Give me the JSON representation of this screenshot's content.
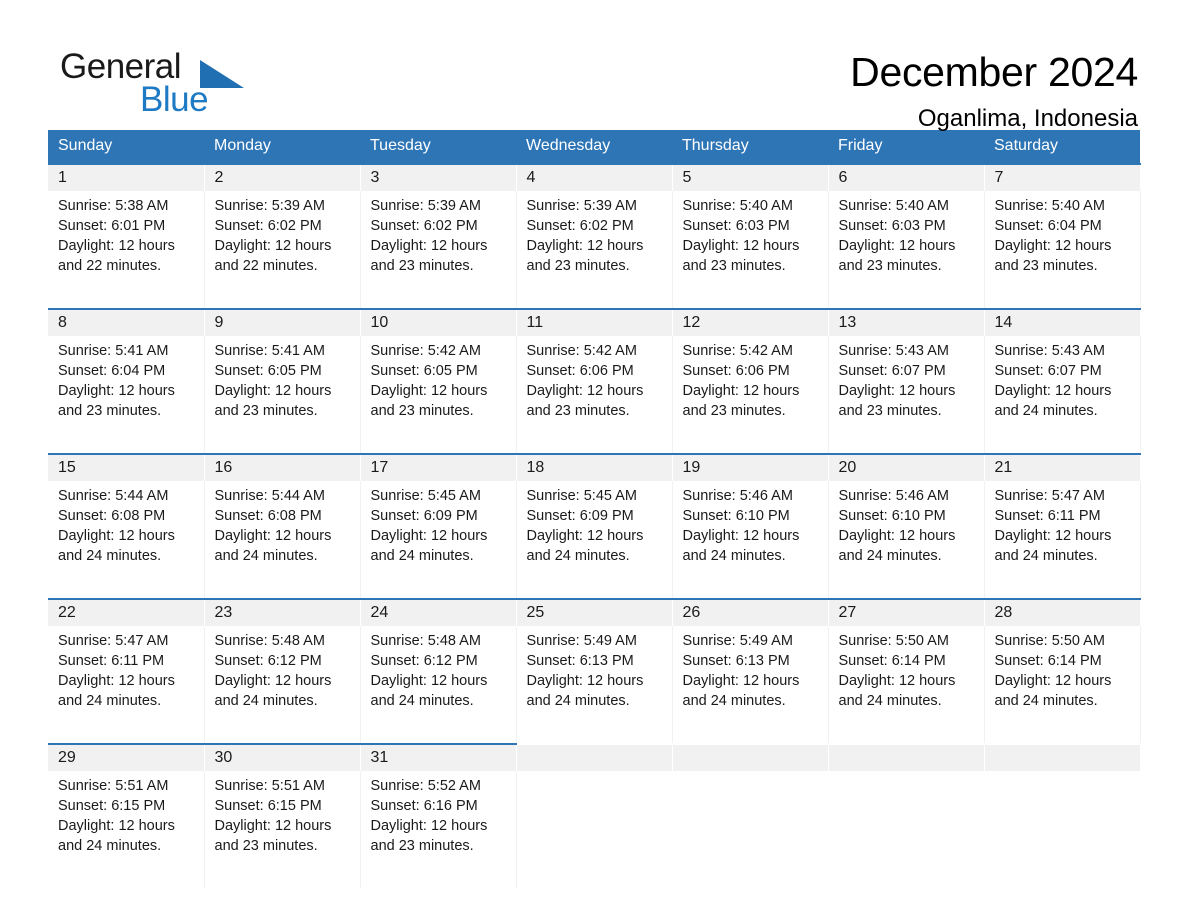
{
  "brand": {
    "name_top": "General",
    "name_bottom": "Blue",
    "triangle_color": "#1f6fb2",
    "blue_text_color": "#1f7ac4"
  },
  "header": {
    "title": "December 2024",
    "location": "Oganlima, Indonesia"
  },
  "theme": {
    "header_blue": "#2e75b6",
    "day_band_gray": "#f1f1f1",
    "text": "#1a1a1a"
  },
  "weekday_headers": [
    "Sunday",
    "Monday",
    "Tuesday",
    "Wednesday",
    "Thursday",
    "Friday",
    "Saturday"
  ],
  "weeks": [
    {
      "days": [
        {
          "number": "1",
          "sunrise": "Sunrise: 5:38 AM",
          "sunset": "Sunset: 6:01 PM",
          "daylight1": "Daylight: 12 hours",
          "daylight2": "and 22 minutes."
        },
        {
          "number": "2",
          "sunrise": "Sunrise: 5:39 AM",
          "sunset": "Sunset: 6:02 PM",
          "daylight1": "Daylight: 12 hours",
          "daylight2": "and 22 minutes."
        },
        {
          "number": "3",
          "sunrise": "Sunrise: 5:39 AM",
          "sunset": "Sunset: 6:02 PM",
          "daylight1": "Daylight: 12 hours",
          "daylight2": "and 23 minutes."
        },
        {
          "number": "4",
          "sunrise": "Sunrise: 5:39 AM",
          "sunset": "Sunset: 6:02 PM",
          "daylight1": "Daylight: 12 hours",
          "daylight2": "and 23 minutes."
        },
        {
          "number": "5",
          "sunrise": "Sunrise: 5:40 AM",
          "sunset": "Sunset: 6:03 PM",
          "daylight1": "Daylight: 12 hours",
          "daylight2": "and 23 minutes."
        },
        {
          "number": "6",
          "sunrise": "Sunrise: 5:40 AM",
          "sunset": "Sunset: 6:03 PM",
          "daylight1": "Daylight: 12 hours",
          "daylight2": "and 23 minutes."
        },
        {
          "number": "7",
          "sunrise": "Sunrise: 5:40 AM",
          "sunset": "Sunset: 6:04 PM",
          "daylight1": "Daylight: 12 hours",
          "daylight2": "and 23 minutes."
        }
      ]
    },
    {
      "days": [
        {
          "number": "8",
          "sunrise": "Sunrise: 5:41 AM",
          "sunset": "Sunset: 6:04 PM",
          "daylight1": "Daylight: 12 hours",
          "daylight2": "and 23 minutes."
        },
        {
          "number": "9",
          "sunrise": "Sunrise: 5:41 AM",
          "sunset": "Sunset: 6:05 PM",
          "daylight1": "Daylight: 12 hours",
          "daylight2": "and 23 minutes."
        },
        {
          "number": "10",
          "sunrise": "Sunrise: 5:42 AM",
          "sunset": "Sunset: 6:05 PM",
          "daylight1": "Daylight: 12 hours",
          "daylight2": "and 23 minutes."
        },
        {
          "number": "11",
          "sunrise": "Sunrise: 5:42 AM",
          "sunset": "Sunset: 6:06 PM",
          "daylight1": "Daylight: 12 hours",
          "daylight2": "and 23 minutes."
        },
        {
          "number": "12",
          "sunrise": "Sunrise: 5:42 AM",
          "sunset": "Sunset: 6:06 PM",
          "daylight1": "Daylight: 12 hours",
          "daylight2": "and 23 minutes."
        },
        {
          "number": "13",
          "sunrise": "Sunrise: 5:43 AM",
          "sunset": "Sunset: 6:07 PM",
          "daylight1": "Daylight: 12 hours",
          "daylight2": "and 23 minutes."
        },
        {
          "number": "14",
          "sunrise": "Sunrise: 5:43 AM",
          "sunset": "Sunset: 6:07 PM",
          "daylight1": "Daylight: 12 hours",
          "daylight2": "and 24 minutes."
        }
      ]
    },
    {
      "days": [
        {
          "number": "15",
          "sunrise": "Sunrise: 5:44 AM",
          "sunset": "Sunset: 6:08 PM",
          "daylight1": "Daylight: 12 hours",
          "daylight2": "and 24 minutes."
        },
        {
          "number": "16",
          "sunrise": "Sunrise: 5:44 AM",
          "sunset": "Sunset: 6:08 PM",
          "daylight1": "Daylight: 12 hours",
          "daylight2": "and 24 minutes."
        },
        {
          "number": "17",
          "sunrise": "Sunrise: 5:45 AM",
          "sunset": "Sunset: 6:09 PM",
          "daylight1": "Daylight: 12 hours",
          "daylight2": "and 24 minutes."
        },
        {
          "number": "18",
          "sunrise": "Sunrise: 5:45 AM",
          "sunset": "Sunset: 6:09 PM",
          "daylight1": "Daylight: 12 hours",
          "daylight2": "and 24 minutes."
        },
        {
          "number": "19",
          "sunrise": "Sunrise: 5:46 AM",
          "sunset": "Sunset: 6:10 PM",
          "daylight1": "Daylight: 12 hours",
          "daylight2": "and 24 minutes."
        },
        {
          "number": "20",
          "sunrise": "Sunrise: 5:46 AM",
          "sunset": "Sunset: 6:10 PM",
          "daylight1": "Daylight: 12 hours",
          "daylight2": "and 24 minutes."
        },
        {
          "number": "21",
          "sunrise": "Sunrise: 5:47 AM",
          "sunset": "Sunset: 6:11 PM",
          "daylight1": "Daylight: 12 hours",
          "daylight2": "and 24 minutes."
        }
      ]
    },
    {
      "days": [
        {
          "number": "22",
          "sunrise": "Sunrise: 5:47 AM",
          "sunset": "Sunset: 6:11 PM",
          "daylight1": "Daylight: 12 hours",
          "daylight2": "and 24 minutes."
        },
        {
          "number": "23",
          "sunrise": "Sunrise: 5:48 AM",
          "sunset": "Sunset: 6:12 PM",
          "daylight1": "Daylight: 12 hours",
          "daylight2": "and 24 minutes."
        },
        {
          "number": "24",
          "sunrise": "Sunrise: 5:48 AM",
          "sunset": "Sunset: 6:12 PM",
          "daylight1": "Daylight: 12 hours",
          "daylight2": "and 24 minutes."
        },
        {
          "number": "25",
          "sunrise": "Sunrise: 5:49 AM",
          "sunset": "Sunset: 6:13 PM",
          "daylight1": "Daylight: 12 hours",
          "daylight2": "and 24 minutes."
        },
        {
          "number": "26",
          "sunrise": "Sunrise: 5:49 AM",
          "sunset": "Sunset: 6:13 PM",
          "daylight1": "Daylight: 12 hours",
          "daylight2": "and 24 minutes."
        },
        {
          "number": "27",
          "sunrise": "Sunrise: 5:50 AM",
          "sunset": "Sunset: 6:14 PM",
          "daylight1": "Daylight: 12 hours",
          "daylight2": "and 24 minutes."
        },
        {
          "number": "28",
          "sunrise": "Sunrise: 5:50 AM",
          "sunset": "Sunset: 6:14 PM",
          "daylight1": "Daylight: 12 hours",
          "daylight2": "and 24 minutes."
        }
      ]
    },
    {
      "days": [
        {
          "number": "29",
          "sunrise": "Sunrise: 5:51 AM",
          "sunset": "Sunset: 6:15 PM",
          "daylight1": "Daylight: 12 hours",
          "daylight2": "and 24 minutes."
        },
        {
          "number": "30",
          "sunrise": "Sunrise: 5:51 AM",
          "sunset": "Sunset: 6:15 PM",
          "daylight1": "Daylight: 12 hours",
          "daylight2": "and 23 minutes."
        },
        {
          "number": "31",
          "sunrise": "Sunrise: 5:52 AM",
          "sunset": "Sunset: 6:16 PM",
          "daylight1": "Daylight: 12 hours",
          "daylight2": "and 23 minutes."
        },
        {
          "number": "",
          "sunrise": "",
          "sunset": "",
          "daylight1": "",
          "daylight2": ""
        },
        {
          "number": "",
          "sunrise": "",
          "sunset": "",
          "daylight1": "",
          "daylight2": ""
        },
        {
          "number": "",
          "sunrise": "",
          "sunset": "",
          "daylight1": "",
          "daylight2": ""
        },
        {
          "number": "",
          "sunrise": "",
          "sunset": "",
          "daylight1": "",
          "daylight2": ""
        }
      ]
    }
  ]
}
